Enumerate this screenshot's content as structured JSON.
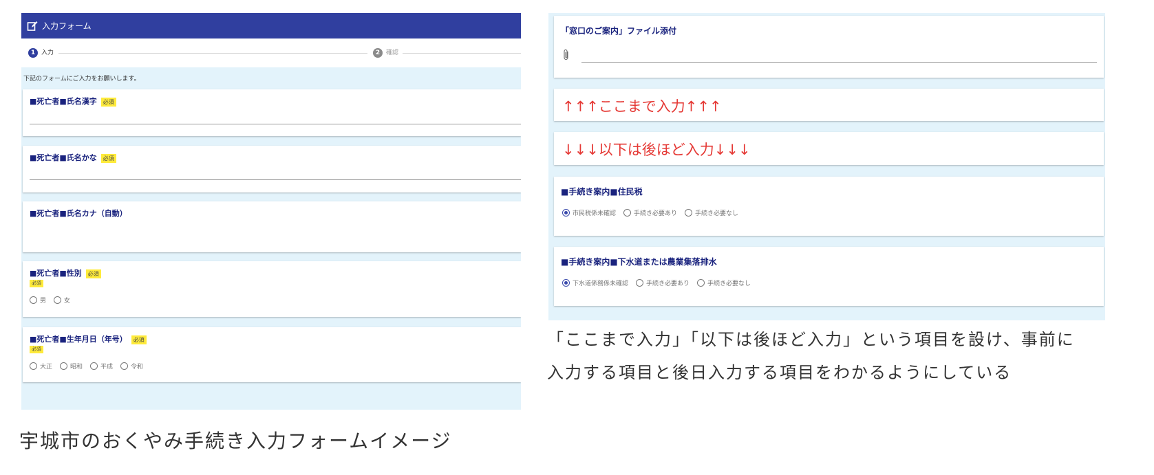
{
  "left_form": {
    "header_title": "入力フォーム",
    "steps": [
      {
        "number": "1",
        "label": "入力"
      },
      {
        "number": "2",
        "label": "確認"
      }
    ],
    "intro": "下記のフォームにご入力をお願いします。",
    "fields": {
      "name_kanji": {
        "title": "■死亡者■氏名漢字",
        "required": "必須"
      },
      "name_kana": {
        "title": "■死亡者■氏名かな",
        "required": "必須"
      },
      "name_katakana": {
        "title": "■死亡者■氏名カナ（自動）"
      },
      "gender": {
        "title": "■死亡者■性別",
        "required": "必須",
        "required_small": "必須",
        "options": [
          "男",
          "女"
        ]
      },
      "birth_era": {
        "title": "■死亡者■生年月日（年号）",
        "required": "必須",
        "required_small": "必須",
        "options": [
          "大正",
          "昭和",
          "平成",
          "令和"
        ]
      }
    },
    "caption": "宇城市のおくやみ手続き入力フォームイメージ"
  },
  "right_form": {
    "attachment": {
      "title": "「窓口のご案内」ファイル添付"
    },
    "note_up": "↑↑↑ここまで入力↑↑↑",
    "note_down": "↓↓↓以下は後ほど入力↓↓↓",
    "resident_tax": {
      "title": "■手続き案内■住民税",
      "options": [
        "市民税係未確認",
        "手続き必要あり",
        "手続き必要なし"
      ],
      "selected": "市民税係未確認"
    },
    "sewer": {
      "title": "■手続き案内■下水道または農業集落排水",
      "options": [
        "下水道係務係未確認",
        "手続き必要あり",
        "手続き必要なし"
      ],
      "selected": "下水道係務係未確認"
    },
    "caption_line1": "「ここまで入力」「以下は後ほど入力」という項目を設け、事前に",
    "caption_line2": "入力する項目と後日入力する項目をわかるようにしている"
  },
  "colors": {
    "header": "#303f9f",
    "accent": "#3949ab",
    "required_badge": "#ffeb3b",
    "note_red": "#e53935",
    "panel_bg": "#e3f3fb"
  },
  "icons": [
    "edit-icon",
    "paperclip-icon"
  ]
}
